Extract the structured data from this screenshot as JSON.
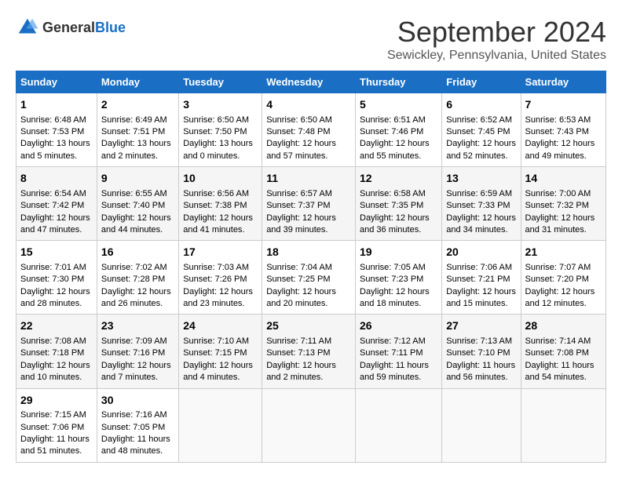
{
  "logo": {
    "general": "General",
    "blue": "Blue"
  },
  "title": "September 2024",
  "subtitle": "Sewickley, Pennsylvania, United States",
  "days_of_week": [
    "Sunday",
    "Monday",
    "Tuesday",
    "Wednesday",
    "Thursday",
    "Friday",
    "Saturday"
  ],
  "weeks": [
    [
      {
        "day": "1",
        "sunrise": "6:48 AM",
        "sunset": "7:53 PM",
        "daylight": "13 hours and 5 minutes."
      },
      {
        "day": "2",
        "sunrise": "6:49 AM",
        "sunset": "7:51 PM",
        "daylight": "13 hours and 2 minutes."
      },
      {
        "day": "3",
        "sunrise": "6:50 AM",
        "sunset": "7:50 PM",
        "daylight": "13 hours and 0 minutes."
      },
      {
        "day": "4",
        "sunrise": "6:50 AM",
        "sunset": "7:48 PM",
        "daylight": "12 hours and 57 minutes."
      },
      {
        "day": "5",
        "sunrise": "6:51 AM",
        "sunset": "7:46 PM",
        "daylight": "12 hours and 55 minutes."
      },
      {
        "day": "6",
        "sunrise": "6:52 AM",
        "sunset": "7:45 PM",
        "daylight": "12 hours and 52 minutes."
      },
      {
        "day": "7",
        "sunrise": "6:53 AM",
        "sunset": "7:43 PM",
        "daylight": "12 hours and 49 minutes."
      }
    ],
    [
      {
        "day": "8",
        "sunrise": "6:54 AM",
        "sunset": "7:42 PM",
        "daylight": "12 hours and 47 minutes."
      },
      {
        "day": "9",
        "sunrise": "6:55 AM",
        "sunset": "7:40 PM",
        "daylight": "12 hours and 44 minutes."
      },
      {
        "day": "10",
        "sunrise": "6:56 AM",
        "sunset": "7:38 PM",
        "daylight": "12 hours and 41 minutes."
      },
      {
        "day": "11",
        "sunrise": "6:57 AM",
        "sunset": "7:37 PM",
        "daylight": "12 hours and 39 minutes."
      },
      {
        "day": "12",
        "sunrise": "6:58 AM",
        "sunset": "7:35 PM",
        "daylight": "12 hours and 36 minutes."
      },
      {
        "day": "13",
        "sunrise": "6:59 AM",
        "sunset": "7:33 PM",
        "daylight": "12 hours and 34 minutes."
      },
      {
        "day": "14",
        "sunrise": "7:00 AM",
        "sunset": "7:32 PM",
        "daylight": "12 hours and 31 minutes."
      }
    ],
    [
      {
        "day": "15",
        "sunrise": "7:01 AM",
        "sunset": "7:30 PM",
        "daylight": "12 hours and 28 minutes."
      },
      {
        "day": "16",
        "sunrise": "7:02 AM",
        "sunset": "7:28 PM",
        "daylight": "12 hours and 26 minutes."
      },
      {
        "day": "17",
        "sunrise": "7:03 AM",
        "sunset": "7:26 PM",
        "daylight": "12 hours and 23 minutes."
      },
      {
        "day": "18",
        "sunrise": "7:04 AM",
        "sunset": "7:25 PM",
        "daylight": "12 hours and 20 minutes."
      },
      {
        "day": "19",
        "sunrise": "7:05 AM",
        "sunset": "7:23 PM",
        "daylight": "12 hours and 18 minutes."
      },
      {
        "day": "20",
        "sunrise": "7:06 AM",
        "sunset": "7:21 PM",
        "daylight": "12 hours and 15 minutes."
      },
      {
        "day": "21",
        "sunrise": "7:07 AM",
        "sunset": "7:20 PM",
        "daylight": "12 hours and 12 minutes."
      }
    ],
    [
      {
        "day": "22",
        "sunrise": "7:08 AM",
        "sunset": "7:18 PM",
        "daylight": "12 hours and 10 minutes."
      },
      {
        "day": "23",
        "sunrise": "7:09 AM",
        "sunset": "7:16 PM",
        "daylight": "12 hours and 7 minutes."
      },
      {
        "day": "24",
        "sunrise": "7:10 AM",
        "sunset": "7:15 PM",
        "daylight": "12 hours and 4 minutes."
      },
      {
        "day": "25",
        "sunrise": "7:11 AM",
        "sunset": "7:13 PM",
        "daylight": "12 hours and 2 minutes."
      },
      {
        "day": "26",
        "sunrise": "7:12 AM",
        "sunset": "7:11 PM",
        "daylight": "11 hours and 59 minutes."
      },
      {
        "day": "27",
        "sunrise": "7:13 AM",
        "sunset": "7:10 PM",
        "daylight": "11 hours and 56 minutes."
      },
      {
        "day": "28",
        "sunrise": "7:14 AM",
        "sunset": "7:08 PM",
        "daylight": "11 hours and 54 minutes."
      }
    ],
    [
      {
        "day": "29",
        "sunrise": "7:15 AM",
        "sunset": "7:06 PM",
        "daylight": "11 hours and 51 minutes."
      },
      {
        "day": "30",
        "sunrise": "7:16 AM",
        "sunset": "7:05 PM",
        "daylight": "11 hours and 48 minutes."
      },
      null,
      null,
      null,
      null,
      null
    ]
  ],
  "labels": {
    "sunrise": "Sunrise: ",
    "sunset": "Sunset: ",
    "daylight": "Daylight: "
  }
}
